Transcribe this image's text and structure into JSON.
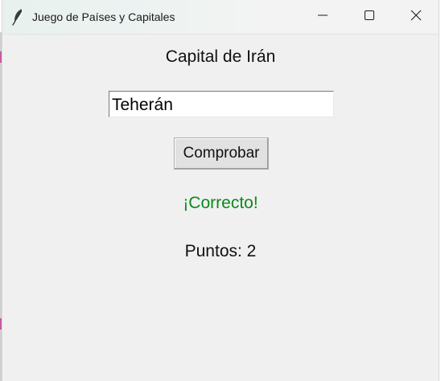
{
  "window": {
    "title": "Juego de Países y Capitales",
    "icon": "feather-icon",
    "controls": [
      "minimize-icon",
      "maximize-icon",
      "close-icon"
    ]
  },
  "game": {
    "question": "Capital de Irán",
    "answer_value": "Teherán",
    "check_label": "Comprobar",
    "feedback": "¡Correcto!",
    "score": "Puntos: 2"
  },
  "colors": {
    "feedback_correct": "#0a8a1a",
    "window_bg": "#f0f0f0",
    "button_bg": "#e1e1e1"
  }
}
